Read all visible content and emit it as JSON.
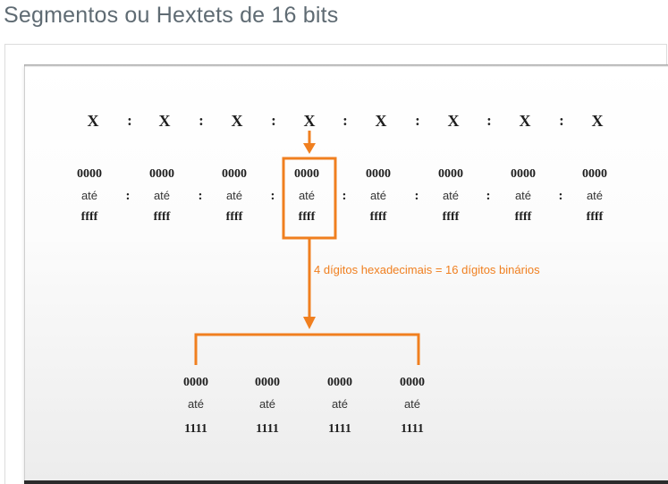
{
  "page": {
    "title": "Segmentos ou Hextets de 16 bits"
  },
  "diagram": {
    "address_symbols": [
      "X",
      "X",
      "X",
      "X",
      "X",
      "X",
      "X",
      "X"
    ],
    "separator": ":",
    "hextet_low": "0000",
    "hextet_word": "até",
    "hextet_high": "ffff",
    "annotation": "4 dígitos hexadecimais = 16 dígitos binários",
    "binary_low": "0000",
    "binary_word": "até",
    "binary_high": "1111",
    "accent_color": "#f07f1f"
  }
}
